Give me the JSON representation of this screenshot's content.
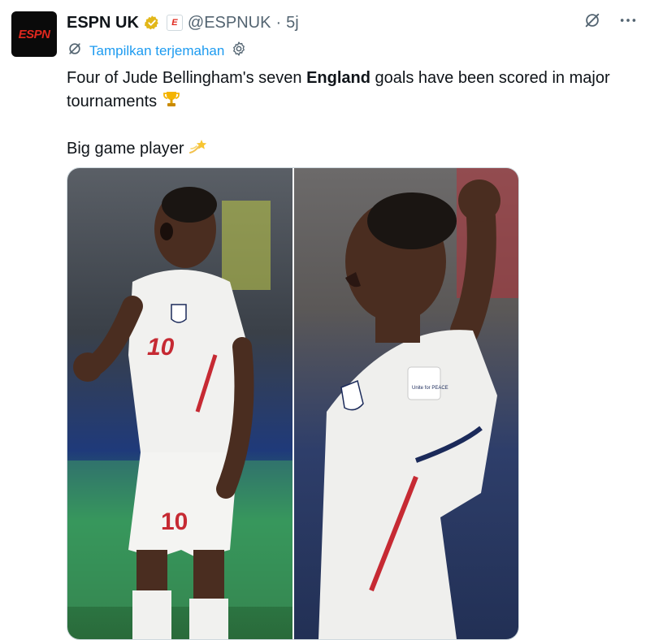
{
  "account": {
    "avatar_text": "ESPN",
    "name": "ESPN UK",
    "affiliate_badge": "E",
    "handle": "@ESPNUK",
    "separator": "·",
    "time": "5j"
  },
  "translate_label": "Tampilkan terjemahan",
  "tweet": {
    "line1_before": "Four of Jude Bellingham's seven ",
    "line1_bold": "England",
    "line1_after": " goals have been scored in major tournaments",
    "line2": "Big game player"
  },
  "media": {
    "left_shirt_number": "10",
    "left_shorts_number": "10",
    "right_badge_text": "Unite for PEACE"
  },
  "colors": {
    "link": "#1d9bf0",
    "espn_red": "#e0281e",
    "verified_gold": "#e2b719",
    "secondary_text": "#536471"
  },
  "icons": {
    "verified": "verified-badge-icon",
    "grok": "grok-icon",
    "more": "more-icon",
    "translate": "translate-icon",
    "settings": "gear-icon",
    "trophy": "trophy-emoji",
    "star": "dizzy-star-emoji"
  }
}
